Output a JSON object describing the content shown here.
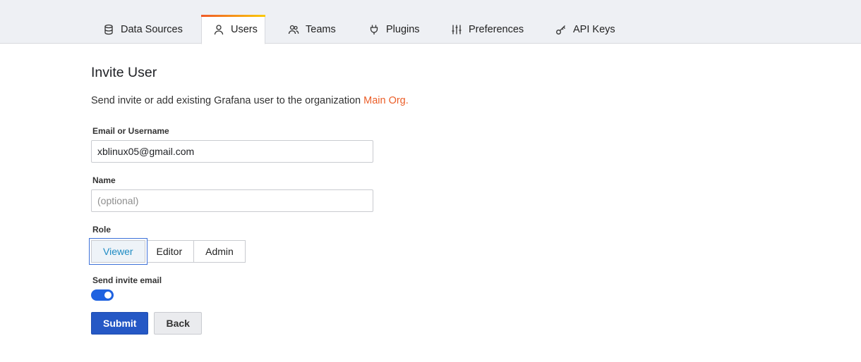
{
  "tabs": [
    {
      "label": "Data Sources",
      "icon": "database-icon",
      "active": false
    },
    {
      "label": "Users",
      "icon": "user-icon",
      "active": true
    },
    {
      "label": "Teams",
      "icon": "users-icon",
      "active": false
    },
    {
      "label": "Plugins",
      "icon": "plug-icon",
      "active": false
    },
    {
      "label": "Preferences",
      "icon": "sliders-icon",
      "active": false
    },
    {
      "label": "API Keys",
      "icon": "key-icon",
      "active": false
    }
  ],
  "page": {
    "title": "Invite User",
    "intro_text": "Send invite or add existing Grafana user to the organization",
    "org_name": "Main Org."
  },
  "form": {
    "email_label": "Email or Username",
    "email_value": "xblinux05@gmail.com",
    "name_label": "Name",
    "name_placeholder": "(optional)",
    "name_value": "",
    "role_label": "Role",
    "roles": [
      "Viewer",
      "Editor",
      "Admin"
    ],
    "selected_role": "Viewer",
    "send_invite_label": "Send invite email",
    "send_invite_enabled": true,
    "submit_label": "Submit",
    "back_label": "Back"
  },
  "colors": {
    "accent": "#2558c5",
    "org_link": "#eb5e28",
    "selected_role_text": "#1e8bc3",
    "tab_gradient_start": "#f05a28",
    "tab_gradient_end": "#fbca0a"
  }
}
